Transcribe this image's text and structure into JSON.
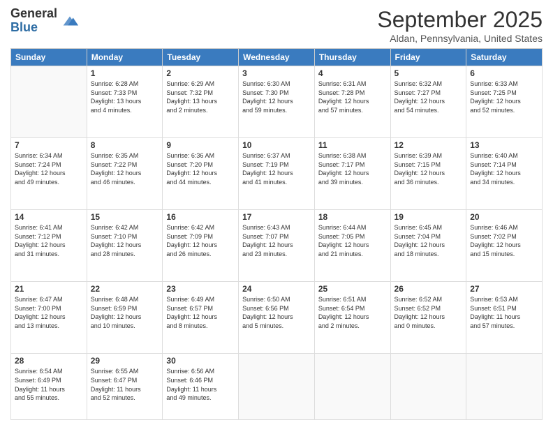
{
  "header": {
    "logo_line1": "General",
    "logo_line2": "Blue",
    "month": "September 2025",
    "location": "Aldan, Pennsylvania, United States"
  },
  "days_of_week": [
    "Sunday",
    "Monday",
    "Tuesday",
    "Wednesday",
    "Thursday",
    "Friday",
    "Saturday"
  ],
  "weeks": [
    [
      {
        "day": "",
        "info": ""
      },
      {
        "day": "1",
        "info": "Sunrise: 6:28 AM\nSunset: 7:33 PM\nDaylight: 13 hours\nand 4 minutes."
      },
      {
        "day": "2",
        "info": "Sunrise: 6:29 AM\nSunset: 7:32 PM\nDaylight: 13 hours\nand 2 minutes."
      },
      {
        "day": "3",
        "info": "Sunrise: 6:30 AM\nSunset: 7:30 PM\nDaylight: 12 hours\nand 59 minutes."
      },
      {
        "day": "4",
        "info": "Sunrise: 6:31 AM\nSunset: 7:28 PM\nDaylight: 12 hours\nand 57 minutes."
      },
      {
        "day": "5",
        "info": "Sunrise: 6:32 AM\nSunset: 7:27 PM\nDaylight: 12 hours\nand 54 minutes."
      },
      {
        "day": "6",
        "info": "Sunrise: 6:33 AM\nSunset: 7:25 PM\nDaylight: 12 hours\nand 52 minutes."
      }
    ],
    [
      {
        "day": "7",
        "info": "Sunrise: 6:34 AM\nSunset: 7:24 PM\nDaylight: 12 hours\nand 49 minutes."
      },
      {
        "day": "8",
        "info": "Sunrise: 6:35 AM\nSunset: 7:22 PM\nDaylight: 12 hours\nand 46 minutes."
      },
      {
        "day": "9",
        "info": "Sunrise: 6:36 AM\nSunset: 7:20 PM\nDaylight: 12 hours\nand 44 minutes."
      },
      {
        "day": "10",
        "info": "Sunrise: 6:37 AM\nSunset: 7:19 PM\nDaylight: 12 hours\nand 41 minutes."
      },
      {
        "day": "11",
        "info": "Sunrise: 6:38 AM\nSunset: 7:17 PM\nDaylight: 12 hours\nand 39 minutes."
      },
      {
        "day": "12",
        "info": "Sunrise: 6:39 AM\nSunset: 7:15 PM\nDaylight: 12 hours\nand 36 minutes."
      },
      {
        "day": "13",
        "info": "Sunrise: 6:40 AM\nSunset: 7:14 PM\nDaylight: 12 hours\nand 34 minutes."
      }
    ],
    [
      {
        "day": "14",
        "info": "Sunrise: 6:41 AM\nSunset: 7:12 PM\nDaylight: 12 hours\nand 31 minutes."
      },
      {
        "day": "15",
        "info": "Sunrise: 6:42 AM\nSunset: 7:10 PM\nDaylight: 12 hours\nand 28 minutes."
      },
      {
        "day": "16",
        "info": "Sunrise: 6:42 AM\nSunset: 7:09 PM\nDaylight: 12 hours\nand 26 minutes."
      },
      {
        "day": "17",
        "info": "Sunrise: 6:43 AM\nSunset: 7:07 PM\nDaylight: 12 hours\nand 23 minutes."
      },
      {
        "day": "18",
        "info": "Sunrise: 6:44 AM\nSunset: 7:05 PM\nDaylight: 12 hours\nand 21 minutes."
      },
      {
        "day": "19",
        "info": "Sunrise: 6:45 AM\nSunset: 7:04 PM\nDaylight: 12 hours\nand 18 minutes."
      },
      {
        "day": "20",
        "info": "Sunrise: 6:46 AM\nSunset: 7:02 PM\nDaylight: 12 hours\nand 15 minutes."
      }
    ],
    [
      {
        "day": "21",
        "info": "Sunrise: 6:47 AM\nSunset: 7:00 PM\nDaylight: 12 hours\nand 13 minutes."
      },
      {
        "day": "22",
        "info": "Sunrise: 6:48 AM\nSunset: 6:59 PM\nDaylight: 12 hours\nand 10 minutes."
      },
      {
        "day": "23",
        "info": "Sunrise: 6:49 AM\nSunset: 6:57 PM\nDaylight: 12 hours\nand 8 minutes."
      },
      {
        "day": "24",
        "info": "Sunrise: 6:50 AM\nSunset: 6:56 PM\nDaylight: 12 hours\nand 5 minutes."
      },
      {
        "day": "25",
        "info": "Sunrise: 6:51 AM\nSunset: 6:54 PM\nDaylight: 12 hours\nand 2 minutes."
      },
      {
        "day": "26",
        "info": "Sunrise: 6:52 AM\nSunset: 6:52 PM\nDaylight: 12 hours\nand 0 minutes."
      },
      {
        "day": "27",
        "info": "Sunrise: 6:53 AM\nSunset: 6:51 PM\nDaylight: 11 hours\nand 57 minutes."
      }
    ],
    [
      {
        "day": "28",
        "info": "Sunrise: 6:54 AM\nSunset: 6:49 PM\nDaylight: 11 hours\nand 55 minutes."
      },
      {
        "day": "29",
        "info": "Sunrise: 6:55 AM\nSunset: 6:47 PM\nDaylight: 11 hours\nand 52 minutes."
      },
      {
        "day": "30",
        "info": "Sunrise: 6:56 AM\nSunset: 6:46 PM\nDaylight: 11 hours\nand 49 minutes."
      },
      {
        "day": "",
        "info": ""
      },
      {
        "day": "",
        "info": ""
      },
      {
        "day": "",
        "info": ""
      },
      {
        "day": "",
        "info": ""
      }
    ]
  ]
}
